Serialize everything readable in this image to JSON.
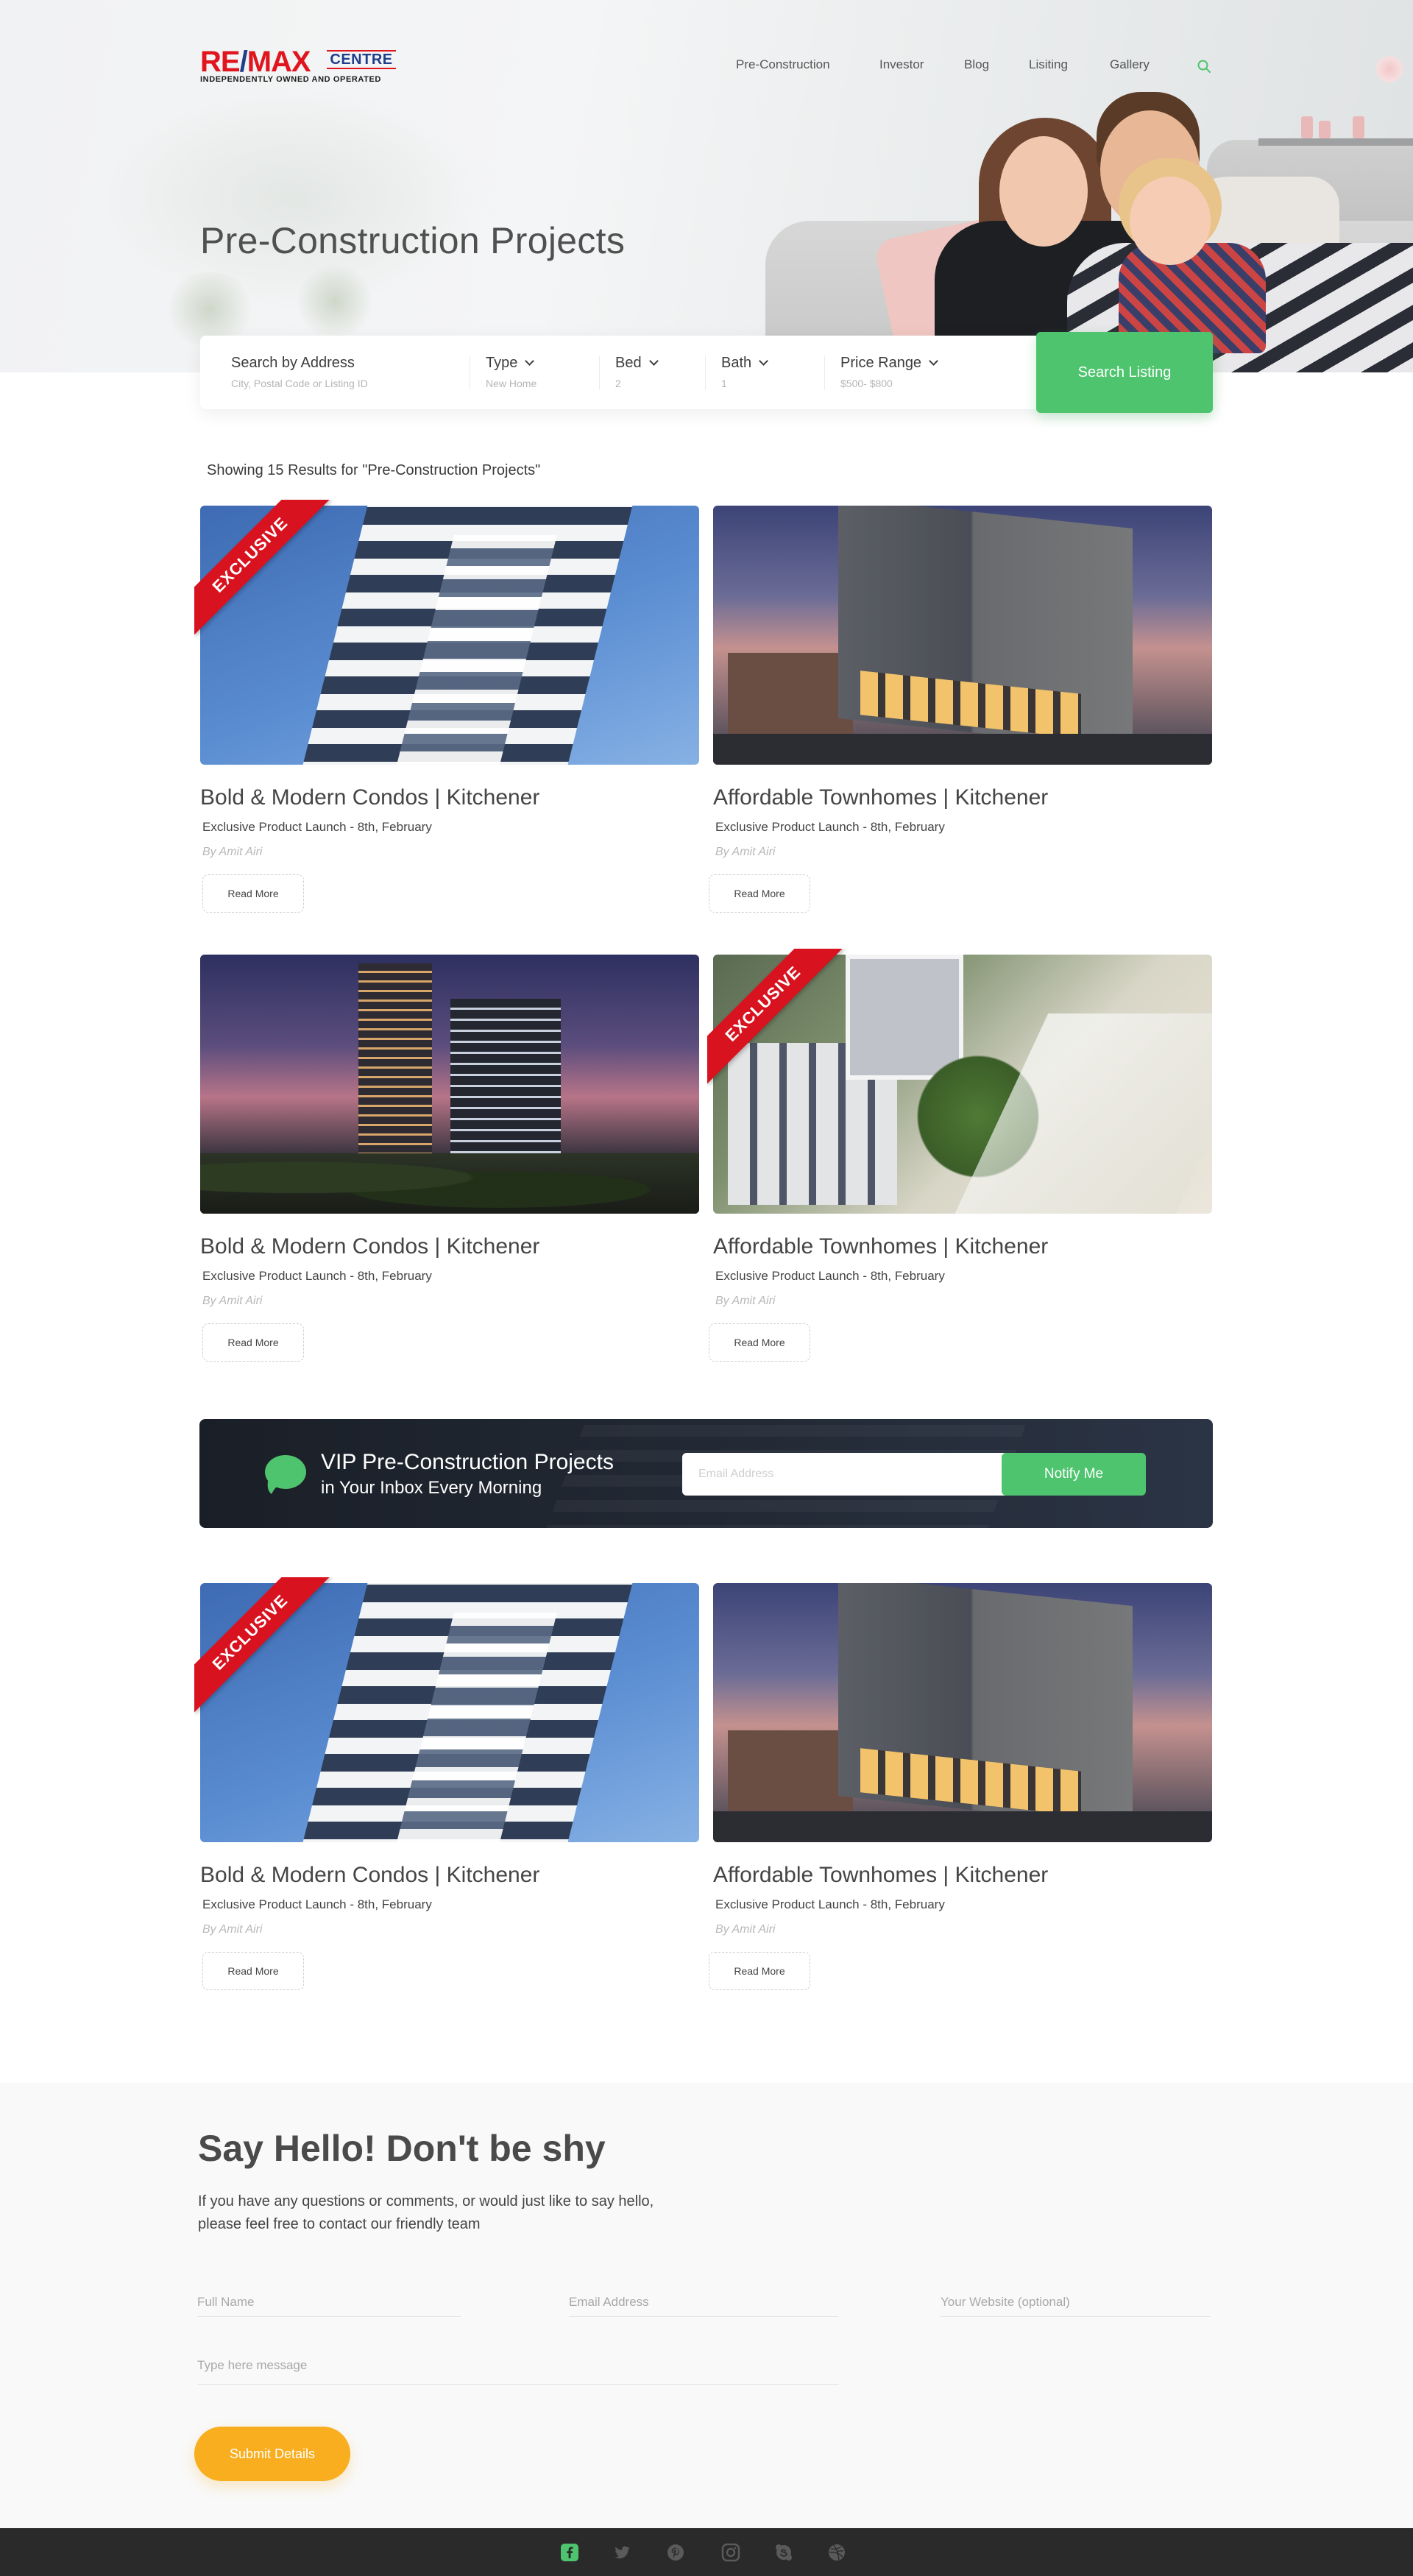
{
  "brand": {
    "logo_main": "RE/MAX",
    "logo_centre": "CENTRE",
    "logo_tagline": "INDEPENDENTLY OWNED AND OPERATED",
    "colors": {
      "red": "#e0151d",
      "blue": "#1f3e8c"
    }
  },
  "nav": {
    "items": [
      "Pre-Construction",
      "Investor",
      "Blog",
      "Lisiting",
      "Gallery"
    ],
    "search_icon": "search-icon"
  },
  "hero": {
    "title": "Pre-Construction Projects"
  },
  "search": {
    "address_label": "Search by Address",
    "address_placeholder": "City, Postal Code or Listing ID",
    "type_label": "Type",
    "type_value": "New Home",
    "bed_label": "Bed",
    "bed_value": "2",
    "bath_label": "Bath",
    "bath_value": "1",
    "price_label": "Price Range",
    "price_value": "$500- $800",
    "button": "Search Listing",
    "accent": "#4fc46e"
  },
  "results_text": "Showing 15 Results for \"Pre-Construction Projects\"",
  "exclusive_label": "EXCLUSIVE",
  "listings": [
    {
      "title": "Bold & Modern Condos | Kitchener",
      "subtitle": "Exclusive Product Launch - 8th, February",
      "author": "By Amit Airi",
      "button": "Read More",
      "exclusive": true
    },
    {
      "title": "Affordable Townhomes | Kitchener",
      "subtitle": "Exclusive Product Launch - 8th, February",
      "author": "By Amit Airi",
      "button": "Read More",
      "exclusive": false
    },
    {
      "title": "Bold & Modern Condos | Kitchener",
      "subtitle": "Exclusive Product Launch - 8th, February",
      "author": "By Amit Airi",
      "button": "Read More",
      "exclusive": false
    },
    {
      "title": "Affordable Townhomes | Kitchener",
      "subtitle": "Exclusive Product Launch - 8th, February",
      "author": "By Amit Airi",
      "button": "Read More",
      "exclusive": true
    },
    {
      "title": "Bold & Modern Condos | Kitchener",
      "subtitle": "Exclusive Product Launch - 8th, February",
      "author": "By Amit Airi",
      "button": "Read More",
      "exclusive": true
    },
    {
      "title": "Affordable Townhomes | Kitchener",
      "subtitle": "Exclusive Product Launch - 8th, February",
      "author": "By Amit Airi",
      "button": "Read More",
      "exclusive": false
    }
  ],
  "newsletter": {
    "title": "VIP Pre-Construction Projects",
    "subtitle": "in Your Inbox Every Morning",
    "email_placeholder": "Email Address",
    "button": "Notify Me",
    "icon": "chat-bubble-icon"
  },
  "contact": {
    "title": "Say Hello! Don't be shy",
    "text_line1": "If you have any questions or comments, or would just like to say hello,",
    "text_line2": "please feel free to contact our friendly team",
    "name_placeholder": "Full Name",
    "email_placeholder": "Email Address",
    "website_placeholder": "Your Website (optional)",
    "message_placeholder": "Type here message",
    "submit": "Submit Details",
    "submit_color": "#f8ae1f"
  },
  "footer": {
    "social_icons": [
      "facebook-icon",
      "twitter-icon",
      "pinterest-icon",
      "instagram-icon",
      "skype-icon",
      "dribbble-icon"
    ],
    "active_color": "#4fc46e"
  }
}
